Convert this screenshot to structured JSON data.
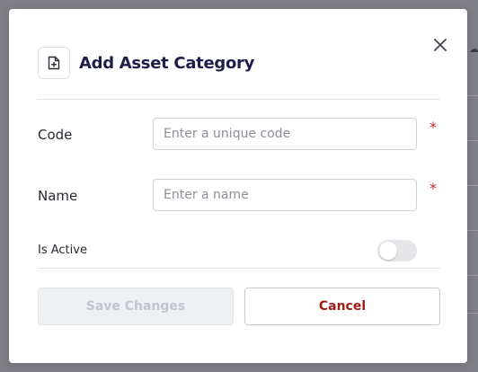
{
  "modal": {
    "title": "Add Asset Category",
    "header_icon": "file-plus-icon",
    "close_icon": "close-icon"
  },
  "form": {
    "code": {
      "label": "Code",
      "placeholder": "Enter a unique code",
      "value": "",
      "required_mark": "*"
    },
    "name": {
      "label": "Name",
      "placeholder": "Enter a name",
      "value": "",
      "required_mark": "*"
    },
    "is_active": {
      "label": "Is Active",
      "checked": false
    }
  },
  "actions": {
    "save_label": "Save Changes",
    "save_disabled": true,
    "cancel_label": "Cancel"
  },
  "colors": {
    "title": "#1f1d4a",
    "required": "#c62828",
    "cancel_text": "#9f1c16",
    "backdrop": "#7f7f86"
  }
}
